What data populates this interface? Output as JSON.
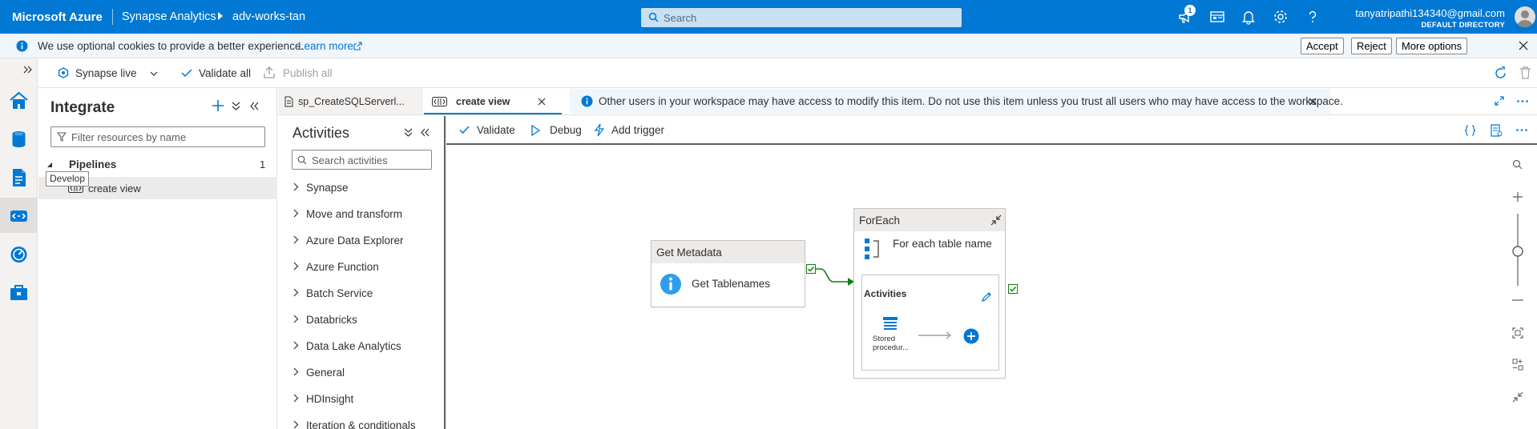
{
  "topbar": {
    "brand": "Microsoft Azure",
    "service": "Synapse Analytics",
    "workspace": "adv-works-tan",
    "search_placeholder": "Search",
    "notification_count": "1",
    "user_email": "tanyatripathi134340@gmail.com",
    "user_directory": "DEFAULT DIRECTORY"
  },
  "cookie_banner": {
    "text": "We use optional cookies to provide a better experience.",
    "link": "Learn more",
    "accept": "Accept",
    "reject": "Reject",
    "more_options": "More options"
  },
  "command_bar": {
    "synapse_live": "Synapse live",
    "validate_all": "Validate all",
    "publish_all": "Publish all"
  },
  "rail": {
    "tooltip": "Develop"
  },
  "integrate": {
    "title": "Integrate",
    "filter_placeholder": "Filter resources by name",
    "pipelines_label": "Pipelines",
    "pipelines_count": "1",
    "pipeline_item": "create view"
  },
  "tabs": [
    {
      "label": "sp_CreateSQLServerl..."
    },
    {
      "label": "create view"
    }
  ],
  "warning": {
    "text": "Other users in your workspace may have access to modify this item. Do not use this item unless you trust all users who may have access to the workspace."
  },
  "activities_pane": {
    "title": "Activities",
    "search_placeholder": "Search activities",
    "categories": [
      "Synapse",
      "Move and transform",
      "Azure Data Explorer",
      "Azure Function",
      "Batch Service",
      "Databricks",
      "Data Lake Analytics",
      "General",
      "HDInsight",
      "Iteration & conditionals"
    ]
  },
  "canvas_toolbar": {
    "validate": "Validate",
    "debug": "Debug",
    "add_trigger": "Add trigger"
  },
  "canvas": {
    "get_metadata": {
      "header": "Get Metadata",
      "name": "Get Tablenames"
    },
    "foreach": {
      "header": "ForEach",
      "name": "For each table name",
      "inner_title": "Activities",
      "inner_activity_line1": "Stored",
      "inner_activity_line2": "procedur..."
    }
  },
  "colors": {
    "azure_blue": "#0078d4",
    "success_green": "#107c10"
  }
}
